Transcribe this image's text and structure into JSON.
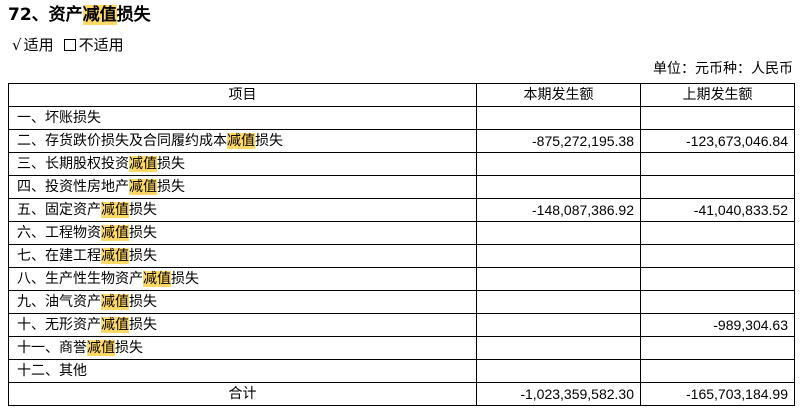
{
  "title": {
    "number": "72、",
    "before": "资产",
    "highlight": "减值",
    "after": "损失"
  },
  "applicability": {
    "check_mark": "√",
    "applicable": "适用",
    "not_applicable": "不适用"
  },
  "unit_line": "单位：元币种：人民币",
  "table": {
    "headers": [
      "项目",
      "本期发生额",
      "上期发生额"
    ],
    "rows": [
      {
        "before": "一、坏账损失",
        "highlight": "",
        "after": "",
        "current": "",
        "previous": ""
      },
      {
        "before": "二、存货跌价损失及合同履约成本",
        "highlight": "减值",
        "after": "损失",
        "current": "-875,272,195.38",
        "previous": "-123,673,046.84"
      },
      {
        "before": "三、长期股权投资",
        "highlight": "减值",
        "after": "损失",
        "current": "",
        "previous": ""
      },
      {
        "before": "四、投资性房地产",
        "highlight": "减值",
        "after": "损失",
        "current": "",
        "previous": ""
      },
      {
        "before": "五、固定资产",
        "highlight": "减值",
        "after": "损失",
        "current": "-148,087,386.92",
        "previous": "-41,040,833.52"
      },
      {
        "before": "六、工程物资",
        "highlight": "减值",
        "after": "损失",
        "current": "",
        "previous": ""
      },
      {
        "before": "七、在建工程",
        "highlight": "减值",
        "after": "损失",
        "current": "",
        "previous": ""
      },
      {
        "before": "八、生产性生物资产",
        "highlight": "减值",
        "after": "损失",
        "current": "",
        "previous": ""
      },
      {
        "before": "九、油气资产",
        "highlight": "减值",
        "after": "损失",
        "current": "",
        "previous": ""
      },
      {
        "before": "十、无形资产",
        "highlight": "减值",
        "after": "损失",
        "current": "",
        "previous": "-989,304.63"
      },
      {
        "before": "十一、商誉",
        "highlight": "减值",
        "after": "损失",
        "current": "",
        "previous": ""
      },
      {
        "before": "十二、其他",
        "highlight": "",
        "after": "",
        "current": "",
        "previous": ""
      }
    ],
    "total": {
      "label": "合计",
      "current": "-1,023,359,582.30",
      "previous": "-165,703,184.99"
    }
  }
}
